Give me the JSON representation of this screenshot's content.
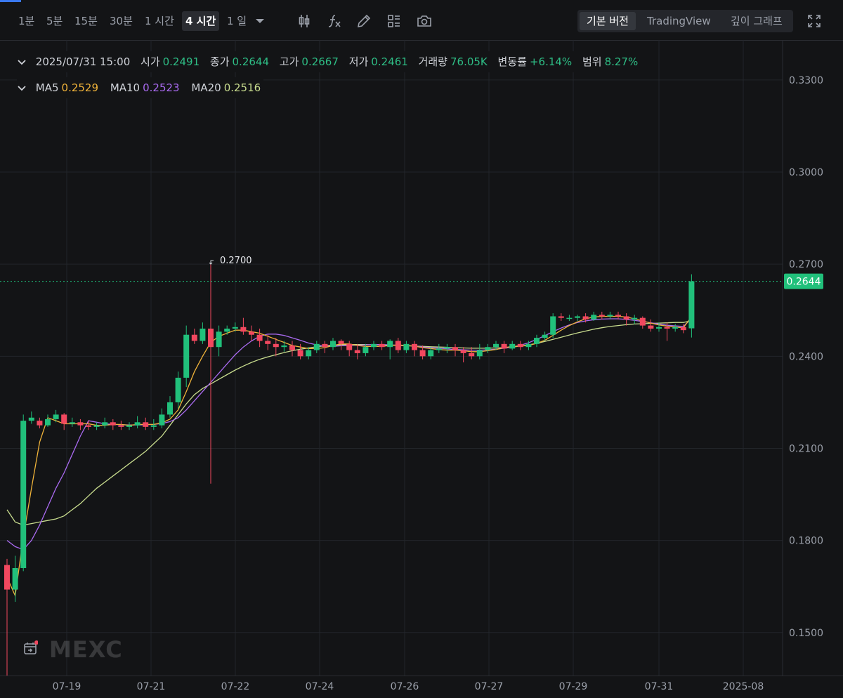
{
  "toolbar": {
    "timeframes": [
      "1분",
      "5분",
      "15분",
      "30분",
      "1 시간",
      "4 시간",
      "1 일"
    ],
    "active_timeframe": "4 시간",
    "icons": [
      "candlestick-icon",
      "fx-icon",
      "pencil-icon",
      "layout-icon",
      "camera-icon"
    ],
    "versions": [
      "기본 버전",
      "TradingView",
      "깊이 그래프"
    ],
    "active_version": "기본 버전"
  },
  "legend": {
    "datetime": "2025/07/31 15:00",
    "open_label": "시가",
    "open": "0.2491",
    "close_label": "종가",
    "close": "0.2644",
    "high_label": "고가",
    "high": "0.2667",
    "low_label": "저가",
    "low": "0.2461",
    "volume_label": "거래량",
    "volume": "76.05K",
    "change_label": "변동률",
    "change": "+6.14%",
    "range_label": "범위",
    "range": "8.27%",
    "ma5_label": "MA5",
    "ma5": "0.2529",
    "ma10_label": "MA10",
    "ma10": "0.2523",
    "ma20_label": "MA20",
    "ma20": "0.2516"
  },
  "chart_data": {
    "type": "candlestick",
    "y_ticks": [
      "0.3300",
      "0.3000",
      "0.2700",
      "0.2400",
      "0.2100",
      "0.1800",
      "0.1500"
    ],
    "x_ticks": [
      "07-19",
      "07-21",
      "07-22",
      "07-24",
      "07-26",
      "07-27",
      "07-29",
      "07-31",
      "2025-08"
    ],
    "ylim": [
      0.136,
      0.343
    ],
    "last_price": "0.2644",
    "high_marker": "0.2700",
    "candles": [
      [
        0.172,
        0.164,
        0.174,
        0.136
      ],
      [
        0.164,
        0.171,
        0.175,
        0.16
      ],
      [
        0.171,
        0.219,
        0.221,
        0.17
      ],
      [
        0.219,
        0.22,
        0.222,
        0.218
      ],
      [
        0.219,
        0.2175,
        0.22,
        0.2165
      ],
      [
        0.2175,
        0.2195,
        0.221,
        0.217
      ],
      [
        0.2195,
        0.221,
        0.2225,
        0.2185
      ],
      [
        0.221,
        0.218,
        0.2215,
        0.216
      ],
      [
        0.218,
        0.2185,
        0.22,
        0.217
      ],
      [
        0.2185,
        0.2175,
        0.2195,
        0.216
      ],
      [
        0.2175,
        0.217,
        0.219,
        0.216
      ],
      [
        0.217,
        0.2175,
        0.2185,
        0.216
      ],
      [
        0.2175,
        0.2185,
        0.22,
        0.2165
      ],
      [
        0.2185,
        0.2175,
        0.2195,
        0.216
      ],
      [
        0.2175,
        0.217,
        0.219,
        0.216
      ],
      [
        0.217,
        0.2175,
        0.2185,
        0.216
      ],
      [
        0.2175,
        0.2185,
        0.2205,
        0.2165
      ],
      [
        0.2185,
        0.217,
        0.22,
        0.216
      ],
      [
        0.217,
        0.2175,
        0.2195,
        0.216
      ],
      [
        0.2175,
        0.221,
        0.223,
        0.2165
      ],
      [
        0.221,
        0.225,
        0.227,
        0.22
      ],
      [
        0.225,
        0.233,
        0.235,
        0.223
      ],
      [
        0.233,
        0.247,
        0.25,
        0.23
      ],
      [
        0.247,
        0.245,
        0.249,
        0.244
      ],
      [
        0.245,
        0.249,
        0.251,
        0.244
      ],
      [
        0.249,
        0.243,
        0.27,
        0.1985
      ],
      [
        0.243,
        0.248,
        0.25,
        0.24
      ],
      [
        0.248,
        0.249,
        0.25,
        0.247
      ],
      [
        0.249,
        0.2495,
        0.251,
        0.248
      ],
      [
        0.2495,
        0.248,
        0.2525,
        0.247
      ],
      [
        0.248,
        0.247,
        0.25,
        0.245
      ],
      [
        0.247,
        0.245,
        0.249,
        0.243
      ],
      [
        0.245,
        0.244,
        0.247,
        0.242
      ],
      [
        0.244,
        0.243,
        0.246,
        0.24
      ],
      [
        0.243,
        0.2435,
        0.245,
        0.2415
      ],
      [
        0.2435,
        0.242,
        0.245,
        0.24
      ],
      [
        0.242,
        0.24,
        0.244,
        0.239
      ],
      [
        0.24,
        0.242,
        0.243,
        0.239
      ],
      [
        0.242,
        0.244,
        0.245,
        0.241
      ],
      [
        0.244,
        0.243,
        0.245,
        0.241
      ],
      [
        0.243,
        0.245,
        0.246,
        0.242
      ],
      [
        0.245,
        0.244,
        0.2455,
        0.242
      ],
      [
        0.244,
        0.242,
        0.245,
        0.24
      ],
      [
        0.242,
        0.241,
        0.244,
        0.239
      ],
      [
        0.241,
        0.243,
        0.244,
        0.24
      ],
      [
        0.243,
        0.244,
        0.245,
        0.242
      ],
      [
        0.244,
        0.243,
        0.245,
        0.242
      ],
      [
        0.243,
        0.245,
        0.2455,
        0.239
      ],
      [
        0.245,
        0.242,
        0.246,
        0.241
      ],
      [
        0.242,
        0.244,
        0.245,
        0.241
      ],
      [
        0.244,
        0.242,
        0.245,
        0.24
      ],
      [
        0.242,
        0.24,
        0.2435,
        0.239
      ],
      [
        0.24,
        0.242,
        0.243,
        0.239
      ],
      [
        0.242,
        0.2425,
        0.244,
        0.241
      ],
      [
        0.2425,
        0.243,
        0.244,
        0.241
      ],
      [
        0.243,
        0.242,
        0.244,
        0.24
      ],
      [
        0.242,
        0.241,
        0.243,
        0.238
      ],
      [
        0.241,
        0.24,
        0.243,
        0.239
      ],
      [
        0.24,
        0.242,
        0.244,
        0.239
      ],
      [
        0.242,
        0.243,
        0.244,
        0.241
      ],
      [
        0.243,
        0.244,
        0.245,
        0.242
      ],
      [
        0.244,
        0.2425,
        0.245,
        0.241
      ],
      [
        0.2425,
        0.244,
        0.245,
        0.242
      ],
      [
        0.244,
        0.243,
        0.245,
        0.242
      ],
      [
        0.243,
        0.244,
        0.245,
        0.242
      ],
      [
        0.244,
        0.246,
        0.247,
        0.243
      ],
      [
        0.246,
        0.247,
        0.248,
        0.245
      ],
      [
        0.247,
        0.253,
        0.254,
        0.246
      ],
      [
        0.253,
        0.2525,
        0.254,
        0.2515
      ],
      [
        0.2525,
        0.2525,
        0.2535,
        0.2515
      ],
      [
        0.2525,
        0.253,
        0.2535,
        0.2515
      ],
      [
        0.253,
        0.252,
        0.254,
        0.251
      ],
      [
        0.252,
        0.2535,
        0.2545,
        0.2515
      ],
      [
        0.2535,
        0.253,
        0.2545,
        0.252
      ],
      [
        0.253,
        0.2535,
        0.2545,
        0.252
      ],
      [
        0.2535,
        0.253,
        0.2545,
        0.252
      ],
      [
        0.253,
        0.252,
        0.254,
        0.25
      ],
      [
        0.252,
        0.2525,
        0.2535,
        0.2505
      ],
      [
        0.2525,
        0.25,
        0.253,
        0.249
      ],
      [
        0.25,
        0.249,
        0.252,
        0.248
      ],
      [
        0.249,
        0.2495,
        0.251,
        0.248
      ],
      [
        0.2495,
        0.249,
        0.251,
        0.245
      ],
      [
        0.249,
        0.2495,
        0.2505,
        0.248
      ],
      [
        0.2495,
        0.2485,
        0.2505,
        0.2475
      ],
      [
        0.2491,
        0.2644,
        0.2667,
        0.2461
      ]
    ],
    "ma5": [
      0.168,
      0.162,
      0.181,
      0.197,
      0.212,
      0.22,
      0.219,
      0.218,
      0.218,
      0.218,
      0.218,
      0.2175,
      0.2175,
      0.2178,
      0.2178,
      0.2175,
      0.2178,
      0.2178,
      0.2178,
      0.2183,
      0.2195,
      0.2225,
      0.2285,
      0.235,
      0.24,
      0.2445,
      0.2465,
      0.2475,
      0.2485,
      0.2485,
      0.248,
      0.2475,
      0.2465,
      0.2455,
      0.2445,
      0.2435,
      0.243,
      0.2425,
      0.2425,
      0.2428,
      0.2435,
      0.244,
      0.244,
      0.2435,
      0.2432,
      0.2432,
      0.2432,
      0.2435,
      0.2437,
      0.2435,
      0.2433,
      0.2428,
      0.2425,
      0.2422,
      0.242,
      0.242,
      0.2418,
      0.2415,
      0.2415,
      0.2418,
      0.2422,
      0.2428,
      0.2432,
      0.2433,
      0.2435,
      0.2442,
      0.2452,
      0.2468,
      0.2485,
      0.25,
      0.2512,
      0.2522,
      0.2528,
      0.253,
      0.253,
      0.253,
      0.2528,
      0.2522,
      0.2515,
      0.2508,
      0.2502,
      0.2498,
      0.2495,
      0.2493,
      0.2529
    ],
    "ma10": [
      0.18,
      0.178,
      0.177,
      0.18,
      0.185,
      0.191,
      0.197,
      0.202,
      0.208,
      0.214,
      0.219,
      0.2185,
      0.218,
      0.2178,
      0.2177,
      0.2176,
      0.2176,
      0.2177,
      0.2178,
      0.2181,
      0.2187,
      0.22,
      0.2225,
      0.2255,
      0.2285,
      0.2315,
      0.2345,
      0.2375,
      0.2405,
      0.243,
      0.245,
      0.2465,
      0.2472,
      0.2472,
      0.2468,
      0.246,
      0.2452,
      0.2443,
      0.2437,
      0.2432,
      0.2432,
      0.2434,
      0.2435,
      0.2436,
      0.2437,
      0.2438,
      0.2438,
      0.2437,
      0.2436,
      0.2435,
      0.2433,
      0.243,
      0.2428,
      0.2426,
      0.2424,
      0.2422,
      0.2421,
      0.242,
      0.242,
      0.2421,
      0.2423,
      0.2426,
      0.243,
      0.2436,
      0.2444,
      0.2455,
      0.2467,
      0.248,
      0.2492,
      0.2502,
      0.251,
      0.2515,
      0.2519,
      0.2521,
      0.2522,
      0.2522,
      0.252,
      0.2517,
      0.2513,
      0.2509,
      0.2505,
      0.2501,
      0.2499,
      0.2497,
      0.2523
    ],
    "ma20": [
      0.19,
      0.186,
      0.185,
      0.1855,
      0.186,
      0.1865,
      0.187,
      0.188,
      0.19,
      0.192,
      0.1945,
      0.197,
      0.199,
      0.201,
      0.203,
      0.205,
      0.207,
      0.209,
      0.2115,
      0.214,
      0.2175,
      0.221,
      0.2245,
      0.2275,
      0.2295,
      0.231,
      0.2325,
      0.234,
      0.2355,
      0.2368,
      0.238,
      0.239,
      0.2398,
      0.2405,
      0.2412,
      0.2418,
      0.2423,
      0.2427,
      0.2431,
      0.2434,
      0.2436,
      0.2437,
      0.2438,
      0.2438,
      0.2438,
      0.2437,
      0.2437,
      0.2436,
      0.2435,
      0.2434,
      0.2433,
      0.2432,
      0.2431,
      0.243,
      0.2429,
      0.2428,
      0.2427,
      0.2426,
      0.2426,
      0.2426,
      0.2427,
      0.2428,
      0.243,
      0.2433,
      0.2437,
      0.2442,
      0.2448,
      0.2455,
      0.2462,
      0.2469,
      0.2476,
      0.2482,
      0.2488,
      0.2493,
      0.2497,
      0.25,
      0.2503,
      0.2505,
      0.2506,
      0.2507,
      0.2508,
      0.2509,
      0.251,
      0.251,
      0.2516
    ]
  },
  "watermark": "MEXC",
  "colors": {
    "up": "#21c07b",
    "down": "#f2485f",
    "ma5": "#f0b33a",
    "ma10": "#a96af0",
    "ma20": "#c8dc8e",
    "price_tag": "#21c07b"
  }
}
